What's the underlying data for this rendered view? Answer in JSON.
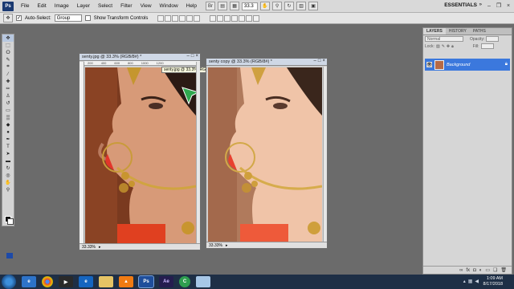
{
  "app": {
    "logo": "Ps",
    "menu": [
      "File",
      "Edit",
      "Image",
      "Layer",
      "Select",
      "Filter",
      "View",
      "Window",
      "Help"
    ],
    "zoom": "33.3",
    "workspace": "ESSENTIALS"
  },
  "options_bar": {
    "auto_select_label": "Auto-Select:",
    "auto_select_value": "Group",
    "show_transform_label": "Show Transform Controls"
  },
  "documents": [
    {
      "title": "senty.jpg @ 33.3% (RGB/8#) *",
      "zoom": "33.33%",
      "ruler": [
        "200",
        "400",
        "600",
        "800",
        "1000",
        "1200",
        "1400",
        "1600"
      ],
      "tooltip": "senty.jpg @ 33.3% (RGB/8#)"
    },
    {
      "title": "senty copy @ 33.3% (RGB/8#) *",
      "zoom": "33.33%"
    }
  ],
  "panel": {
    "tabs": [
      "LAYERS",
      "HISTORY",
      "PATHS"
    ],
    "blend_mode": "Normal",
    "opacity_label": "Opacity:",
    "lock_label": "Lock:",
    "fill_label": "Fill:",
    "layer_name": "Background"
  },
  "taskbar": {
    "time": "1:09 AM",
    "date": "8/17/2018",
    "apps": [
      "ie",
      "chrome",
      "media",
      "ie-blue",
      "folder",
      "vlc",
      "photoshop",
      "after-effects",
      "camtasia",
      "notepad"
    ]
  },
  "colors": {
    "accent": "#3b78dd",
    "taskbar": "#1e2f46",
    "workspace": "#6b6b6b"
  }
}
